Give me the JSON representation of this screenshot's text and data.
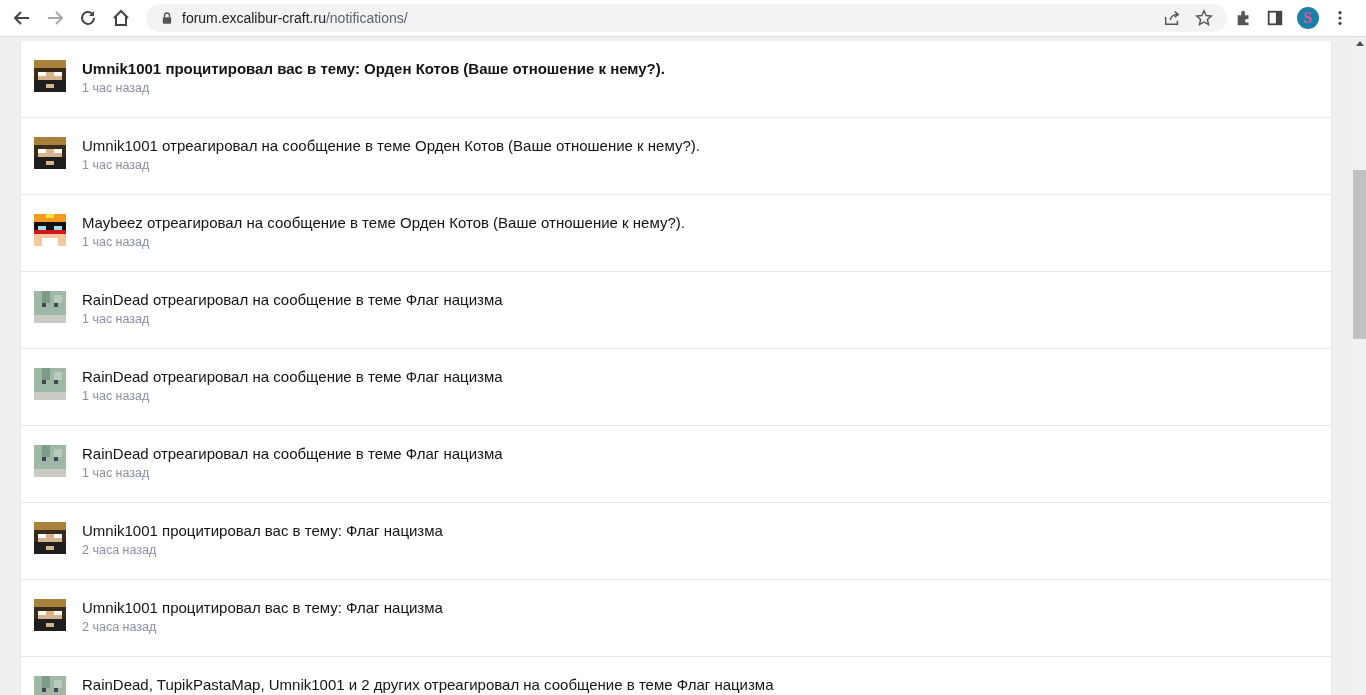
{
  "browser": {
    "url_host": "forum.excalibur-craft.ru",
    "url_path": "/notifications/",
    "profile_initial": "S"
  },
  "notifications": [
    {
      "text": "Umnik1001 процитировал вас в тему: Орден Котов (Ваше отношение к нему?).",
      "time": "1 час назад",
      "unread": true,
      "kind": "bearded"
    },
    {
      "text": "Umnik1001 отреагировал на сообщение в теме Орден Котов (Ваше отношение к нему?).",
      "time": "1 час назад",
      "unread": false,
      "kind": "bearded"
    },
    {
      "text": "Maybeez отреагировал на сообщение в теме Орден Котов (Ваше отношение к нему?).",
      "time": "1 час назад",
      "unread": false,
      "kind": "masked"
    },
    {
      "text": "RainDead отреагировал на сообщение в теме Флаг нацизма",
      "time": "1 час назад",
      "unread": false,
      "kind": "pale"
    },
    {
      "text": "RainDead отреагировал на сообщение в теме Флаг нацизма",
      "time": "1 час назад",
      "unread": false,
      "kind": "pale"
    },
    {
      "text": "RainDead отреагировал на сообщение в теме Флаг нацизма",
      "time": "1 час назад",
      "unread": false,
      "kind": "pale"
    },
    {
      "text": "Umnik1001 процитировал вас в тему: Флаг нацизма",
      "time": "2 часа назад",
      "unread": false,
      "kind": "bearded"
    },
    {
      "text": "Umnik1001 процитировал вас в тему: Флаг нацизма",
      "time": "2 часа назад",
      "unread": false,
      "kind": "bearded"
    },
    {
      "text": "RainDead, TupikPastaMap, Umnik1001 и 2 других отреагировал на сообщение в теме Флаг нацизма",
      "unread": false,
      "kind": "pale"
    }
  ]
}
